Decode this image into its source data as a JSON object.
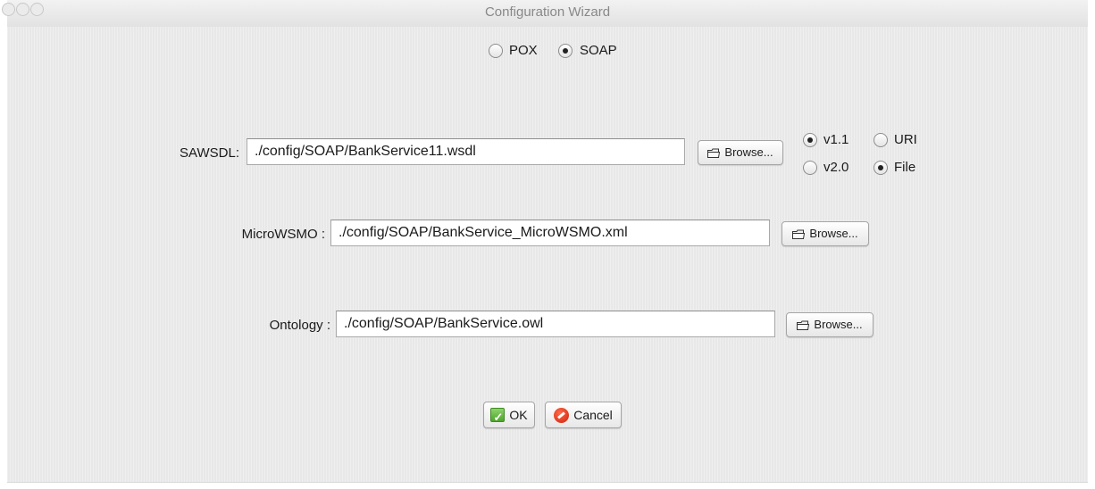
{
  "window": {
    "title": "Configuration Wizard"
  },
  "protocol": {
    "options": [
      {
        "label": "POX",
        "checked": false
      },
      {
        "label": "SOAP",
        "checked": true
      }
    ]
  },
  "sawsdl": {
    "label": "SAWSDL:",
    "value": "./config/SOAP/BankService11.wsdl",
    "browse": "Browse...",
    "version_options": [
      {
        "label": "v1.1",
        "checked": true
      },
      {
        "label": "v2.0",
        "checked": false
      }
    ],
    "source_options": [
      {
        "label": "URI",
        "checked": false
      },
      {
        "label": "File",
        "checked": true
      }
    ]
  },
  "microwsmo": {
    "label": "MicroWSMO :",
    "value": "./config/SOAP/BankService_MicroWSMO.xml",
    "browse": "Browse..."
  },
  "ontology": {
    "label": "Ontology :",
    "value": "./config/SOAP/BankService.owl",
    "browse": "Browse..."
  },
  "actions": {
    "ok": "OK",
    "cancel": "Cancel"
  }
}
